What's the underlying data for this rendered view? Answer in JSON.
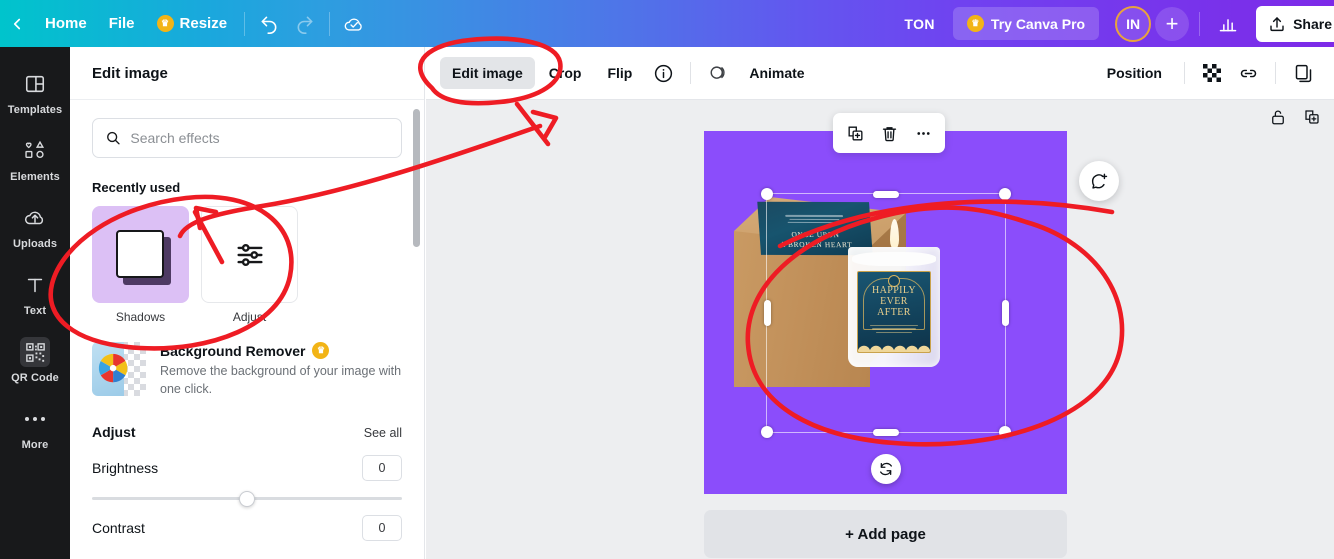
{
  "topbar": {
    "back_icon": "chevron-left-icon",
    "home": "Home",
    "file": "File",
    "resize": "Resize",
    "resize_crown": "crown-icon",
    "undo_icon": "undo-icon",
    "redo_icon": "redo-icon",
    "saved_icon": "cloud-check-icon",
    "account": "TON",
    "pro": "Try Canva Pro",
    "pro_crown": "crown-icon",
    "avatar_initials": "IN",
    "add_icon": "plus-icon",
    "insights_icon": "bar-chart-icon",
    "share": "Share",
    "share_icon": "upload-icon"
  },
  "rail": {
    "items": [
      {
        "label": "Templates",
        "icon": "templates-grid-icon",
        "active": false
      },
      {
        "label": "Elements",
        "icon": "shapes-icon",
        "active": false
      },
      {
        "label": "Uploads",
        "icon": "cloud-upload-icon",
        "active": false
      },
      {
        "label": "Text",
        "icon": "text-t-icon",
        "active": false
      },
      {
        "label": "QR Code",
        "icon": "qr-code-icon",
        "active": true
      },
      {
        "label": "More",
        "icon": "ellipsis-icon",
        "active": false
      }
    ]
  },
  "panel": {
    "title": "Edit image",
    "search": {
      "placeholder": "Search effects",
      "value": "",
      "icon": "search-icon"
    },
    "recently_used_title": "Recently used",
    "effects": [
      {
        "name": "Shadows",
        "icon": "shadow-swatch-icon"
      },
      {
        "name": "Adjust",
        "icon": "sliders-icon"
      }
    ],
    "promo": {
      "title": "Background Remover",
      "badge": "crown-icon",
      "description": "Remove the background of your image with one click.",
      "icon": "beach-ball-transparency-icon"
    },
    "adjust": {
      "title": "Adjust",
      "see_all": "See all",
      "sliders": [
        {
          "label": "Brightness",
          "value": "0",
          "position_pct": 50
        },
        {
          "label": "Contrast",
          "value": "0",
          "position_pct": 50
        }
      ]
    }
  },
  "editbar": {
    "edit_image": "Edit image",
    "crop": "Crop",
    "flip": "Flip",
    "info_icon": "info-circle-icon",
    "animate": "Animate",
    "animate_icon": "animate-circles-icon",
    "position": "Position",
    "transparency_icon": "transparency-checker-icon",
    "link_icon": "link-icon",
    "duplicate_icon": "duplicate-icon"
  },
  "stage": {
    "page_tools": [
      {
        "icon": "lock-open-icon",
        "name": "lock-page"
      },
      {
        "icon": "duplicate-page-icon",
        "name": "duplicate-page"
      },
      {
        "icon": "add-page-icon",
        "name": "add-page-top"
      }
    ],
    "float_tools": [
      {
        "icon": "duplicate-icon",
        "name": "duplicate-element"
      },
      {
        "icon": "trash-icon",
        "name": "delete-element"
      },
      {
        "icon": "ellipsis-icon",
        "name": "more-options"
      }
    ],
    "comment_icon": "add-comment-icon",
    "rotate_icon": "rotate-icon",
    "add_page": "+ Add page",
    "canvas_bg": "#8b4dfb"
  },
  "artwork": {
    "box_label_line1": "ONCE UPON",
    "box_label_line2": "A BROKEN HEART",
    "candle_line1": "HAPPILY",
    "candle_line2": "EVER",
    "candle_line3": "AFTER"
  },
  "annotation": {
    "color": "#ee1c24",
    "marks": [
      "circle-around-edit-image-tab",
      "arrow-to-shadows-effect",
      "circle-around-shadows-card",
      "circle-around-canvas-image"
    ]
  }
}
